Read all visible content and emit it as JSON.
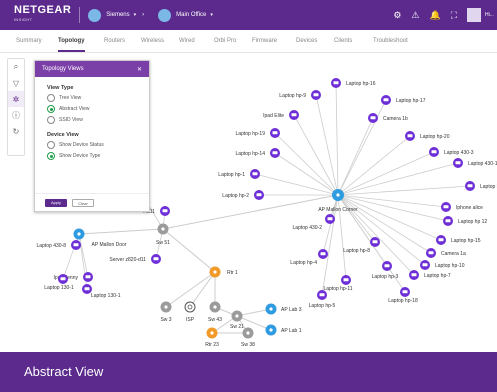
{
  "header": {
    "logo_text": "NETGEAR",
    "logo_sub": "INSIGHT",
    "org_label": "Siemens",
    "location_label": "Main Office",
    "icons": [
      "settings-icon",
      "alerts-icon",
      "notifications-icon",
      "fullscreen-icon",
      "user-avatar"
    ],
    "user_label": "Hi..."
  },
  "tabs": [
    {
      "label": "Summary",
      "active": false
    },
    {
      "label": "Topology",
      "active": true
    },
    {
      "label": "Routers",
      "active": false
    },
    {
      "label": "Wireless",
      "active": false
    },
    {
      "label": "Wired",
      "active": false
    },
    {
      "label": "Orbi Pro",
      "active": false
    },
    {
      "label": "Firmware",
      "active": false
    },
    {
      "label": "Devices",
      "active": false
    },
    {
      "label": "Clients",
      "active": false
    },
    {
      "label": "Troubleshoot",
      "active": false
    }
  ],
  "toolstrip": {
    "icons": [
      "search-icon",
      "filter-icon",
      "settings-icon",
      "info-icon",
      "history-icon"
    ]
  },
  "topology_panel": {
    "title": "Topology Views",
    "view_type_title": "View Type",
    "view_types": [
      {
        "label": "Tree View",
        "checked": false
      },
      {
        "label": "Abstract View",
        "checked": true
      },
      {
        "label": "SSID View",
        "checked": false
      }
    ],
    "device_view_title": "Device View",
    "device_views": [
      {
        "label": "Show Device Status",
        "checked": false
      },
      {
        "label": "Show Device Type",
        "checked": true
      }
    ],
    "apply_label": "Apply",
    "clear_label": "Clear"
  },
  "caption": "Abstract View",
  "colors": {
    "brand": "#5b2a8c",
    "client": "#6e2fd6",
    "ap": "#2f9be0",
    "router": "#f09a2a",
    "switch": "#9b9b9b",
    "link": "#cccccc"
  },
  "topology": {
    "hubs": [
      {
        "id": "ap-mallon-corner",
        "label": "AP Mallon Corner",
        "type": "ap"
      },
      {
        "id": "ap-mallon-door",
        "label": "AP Mallon Door",
        "type": "ap"
      },
      {
        "id": "ap-lab-1",
        "label": "AP Lab 1",
        "type": "ap"
      },
      {
        "id": "ap-lab-3",
        "label": "AP Lab 3",
        "type": "ap"
      },
      {
        "id": "rtr-1",
        "label": "Rtr 1",
        "type": "router"
      },
      {
        "id": "rtr-23",
        "label": "Rtr 23",
        "type": "router"
      },
      {
        "id": "sw-51",
        "label": "Sw 51",
        "type": "switch"
      },
      {
        "id": "sw-3",
        "label": "Sw 3",
        "type": "switch"
      },
      {
        "id": "sw-43",
        "label": "Sw 43",
        "type": "switch"
      },
      {
        "id": "sw-21",
        "label": "Sw 21",
        "type": "switch"
      },
      {
        "id": "sw-38",
        "label": "Sw 38",
        "type": "switch"
      },
      {
        "id": "isp",
        "label": "ISP",
        "type": "isp"
      }
    ],
    "clients": [
      {
        "label": "Laptop hp-16"
      },
      {
        "label": "Laptop hp-9"
      },
      {
        "label": "Laptop hp-17"
      },
      {
        "label": "Ipad Elite"
      },
      {
        "label": "Camera 1b"
      },
      {
        "label": "Laptop hp-19"
      },
      {
        "label": "Laptop hp-20"
      },
      {
        "label": "Laptop hp-14"
      },
      {
        "label": "Laptop 430-3"
      },
      {
        "label": "Laptop 430-1"
      },
      {
        "label": "Laptop hp-1"
      },
      {
        "label": "Laptop hp-13"
      },
      {
        "label": "Laptop hp-2"
      },
      {
        "label": "Iphone alice"
      },
      {
        "label": "Laptop hp 12"
      },
      {
        "label": "Laptop 430-2"
      },
      {
        "label": "Laptop hp-15"
      },
      {
        "label": "Laptop hp-8"
      },
      {
        "label": "Camera 1a"
      },
      {
        "label": "Laptop hp-4"
      },
      {
        "label": "Laptop hp-10"
      },
      {
        "label": "Laptop hp-7"
      },
      {
        "label": "Laptop hp-3"
      },
      {
        "label": "Laptop hp-11"
      },
      {
        "label": "Laptop hp-18"
      },
      {
        "label": "Laptop hp-5"
      },
      {
        "label": "Laptop 430-8"
      },
      {
        "label": "Ipad Jenny"
      },
      {
        "label": "Laptop 130-1"
      },
      {
        "label": "Laptop 130-1"
      },
      {
        "label": "Server z820-d11"
      },
      {
        "label": "y"
      },
      {
        "label": "...d11"
      }
    ]
  }
}
